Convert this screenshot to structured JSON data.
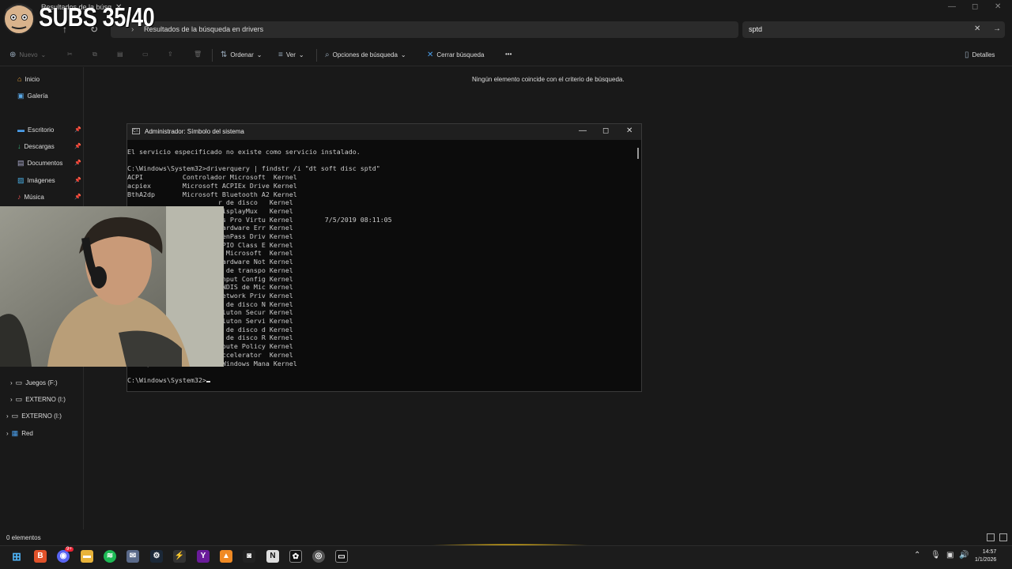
{
  "overlay": {
    "subs_text": "SUBS 35/40"
  },
  "titlebar": {
    "tab_title": "Resultados de la búsq",
    "tab_close": "✕",
    "min": "—",
    "max": "◻",
    "close": "✕"
  },
  "nav": {
    "back": "←",
    "forward": "→",
    "up": "↑",
    "refresh": "↻",
    "chevron": "›"
  },
  "address": {
    "path": "Resultados de la búsqueda en drivers"
  },
  "search": {
    "value": "sptd",
    "clear": "✕",
    "go": "→"
  },
  "toolbar": {
    "new_label": "Nuevo",
    "sort_label": "Ordenar",
    "view_label": "Ver",
    "search_options_label": "Opciones de búsqueda",
    "close_search_label": "Cerrar búsqueda",
    "more_label": "•••",
    "details_label": "Detalles"
  },
  "sidebar": {
    "items": [
      {
        "label": "Inicio",
        "icon": "home-icon"
      },
      {
        "label": "Galería",
        "icon": "gallery-icon"
      },
      {
        "label": "Escritorio",
        "icon": "desktop-icon"
      },
      {
        "label": "Descargas",
        "icon": "download-icon"
      },
      {
        "label": "Documentos",
        "icon": "document-icon"
      },
      {
        "label": "Imágenes",
        "icon": "pictures-icon"
      },
      {
        "label": "Música",
        "icon": "music-icon"
      },
      {
        "label": "Juegos (F:)",
        "icon": "drive-icon"
      },
      {
        "label": "EXTERNO (I:)",
        "icon": "drive-icon"
      },
      {
        "label": "EXTERNO (I:)",
        "icon": "drive-icon"
      },
      {
        "label": "Red",
        "icon": "network-icon"
      }
    ]
  },
  "main": {
    "no_results": "Ningún elemento coincide con el criterio de búsqueda."
  },
  "status": {
    "count": "0 elementos"
  },
  "cmd": {
    "title": "Administrador: Símbolo del sistema",
    "icon_text": "C:\\",
    "lines": [
      "El servicio especificado no existe como servicio instalado.",
      "",
      "C:\\Windows\\System32>driverquery | findstr /i \"dt soft disc sptd\"",
      "ACPI          Controlador Microsoft  Kernel",
      "acpiex        Microsoft ACPIEx Drive Kernel",
      "BthA2dp       Microsoft Bluetooth A2 Kernel",
      "                       r de disco   Kernel",
      "                       DisplayMux   Kernel",
      "                       ls Pro Virtu Kernel        7/5/2019 08:11:05",
      "                       Hardware Err Kernel",
      "                       GenPass Driv Kernel",
      "                       GPIO Class E Kernel",
      "                       e Microsoft  Kernel",
      "                       Hardware Not Kernel",
      "                       r de transpo Kernel",
      "                       Input Config Kernel",
      "                        NDIS de Mic Kernel",
      "                       Network Priv Kernel",
      "                       r de disco N Kernel",
      "                       Pluton Secur Kernel",
      "                       Pluton Servi Kernel",
      "                       r de disco d Kernel",
      "                       r de disco R Kernel",
      "                       Route Policy Kernel",
      "                       Accelerator  Kernel",
      "WmiAcpi       Microsoft Windows Mana Kernel",
      "",
      "C:\\Windows\\System32>"
    ]
  },
  "clock": {
    "time": "14:57",
    "date": "1/1/2026"
  },
  "taskbar": {
    "badge": "9+",
    "apps": [
      "start-icon",
      "brave-icon",
      "discord-icon",
      "files-icon",
      "spotify-icon",
      "mail-icon",
      "steam-icon",
      "app-icon",
      "yahoo-icon",
      "vlc-icon",
      "mask-icon",
      "notion-icon",
      "chatgpt-icon",
      "chrome-icon",
      "terminal-icon"
    ]
  },
  "colors": {
    "accent": "#4a9eea",
    "cmd_bg": "#0c0c0c",
    "explorer_bg": "#191919"
  }
}
